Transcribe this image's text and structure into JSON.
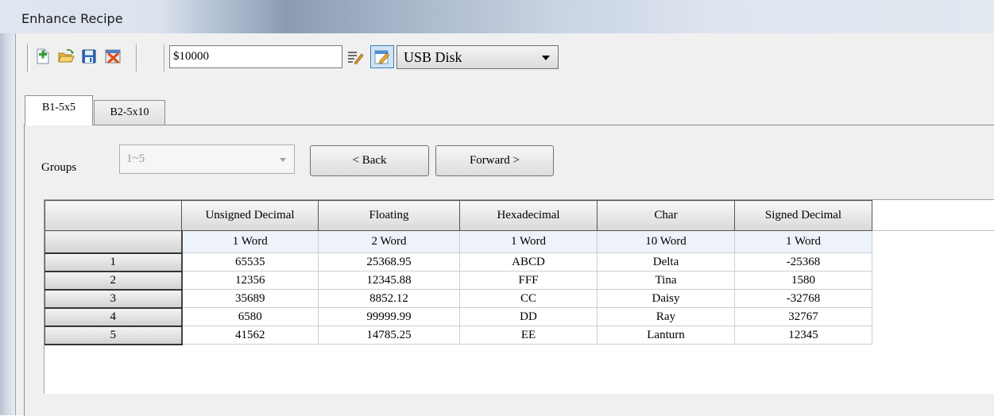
{
  "window": {
    "title": "Enhance Recipe"
  },
  "toolbar": {
    "address_value": "$10000",
    "storage_selected": "USB Disk",
    "icons": [
      "new-icon",
      "open-folder-icon",
      "save-icon",
      "delete-icon",
      "edit-icon",
      "edit-mode-icon"
    ]
  },
  "tabs": [
    {
      "label": "B1-5x5",
      "active": true
    },
    {
      "label": "B2-5x10",
      "active": false
    }
  ],
  "groups": {
    "label": "Groups",
    "selected": "1~5",
    "back_label": "< Back",
    "forward_label": "Forward >"
  },
  "table": {
    "columns": [
      {
        "header": "Unsigned Decimal",
        "size": "1 Word"
      },
      {
        "header": "Floating",
        "size": "2 Word"
      },
      {
        "header": "Hexadecimal",
        "size": "1 Word"
      },
      {
        "header": "Char",
        "size": "10 Word"
      },
      {
        "header": "Signed Decimal",
        "size": "1 Word"
      }
    ],
    "rows": [
      {
        "index": "1",
        "cells": [
          "65535",
          "25368.95",
          "ABCD",
          "Delta",
          "-25368"
        ]
      },
      {
        "index": "2",
        "cells": [
          "12356",
          "12345.88",
          "FFF",
          "Tina",
          "1580"
        ]
      },
      {
        "index": "3",
        "cells": [
          "35689",
          "8852.12",
          "CC",
          "Daisy",
          "-32768"
        ]
      },
      {
        "index": "4",
        "cells": [
          "6580",
          "99999.99",
          "DD",
          "Ray",
          "32767"
        ]
      },
      {
        "index": "5",
        "cells": [
          "41562",
          "14785.25",
          "EE",
          "Lanturn",
          "12345"
        ]
      }
    ]
  },
  "colors": {
    "subheader_bg": "#eef2f9",
    "active_edit_bg": "#cfe4f6",
    "accent_border": "#3c7fb1"
  }
}
